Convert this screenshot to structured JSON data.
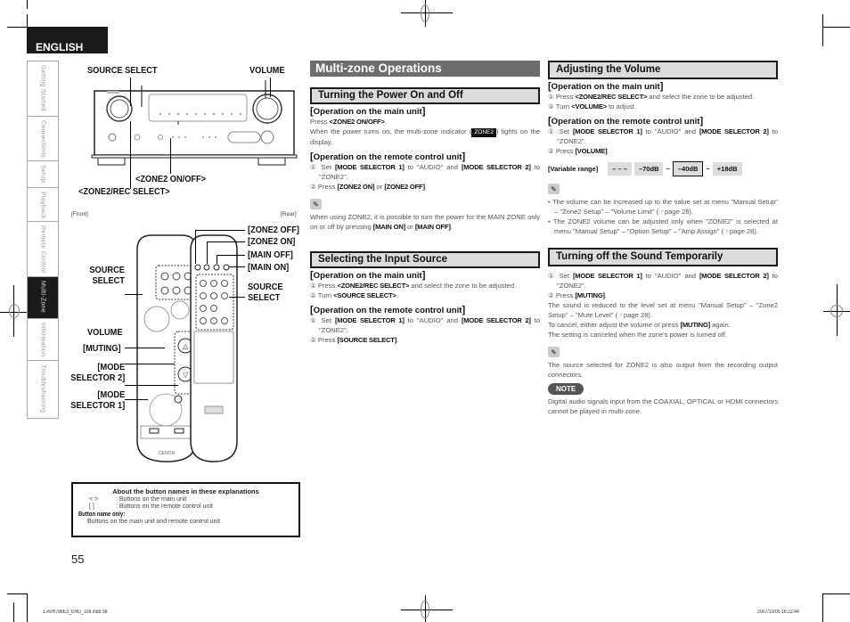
{
  "language_tab": "ENGLISH",
  "side_nav": [
    {
      "label": "Getting Started",
      "active": false
    },
    {
      "label": "Connections",
      "active": false
    },
    {
      "label": "Setup",
      "active": false
    },
    {
      "label": "Playback",
      "active": false
    },
    {
      "label": "Remote Control",
      "active": false
    },
    {
      "label": "Multi-Zone",
      "active": true
    },
    {
      "label": "Information",
      "active": false
    },
    {
      "label": "Troubleshooting",
      "active": false
    }
  ],
  "illustration": {
    "main_unit": {
      "source_select": "SOURCE SELECT",
      "volume": "VOLUME",
      "zone2_on_off": "<ZONE2 ON/OFF>",
      "zone2_rec_select": "<ZONE2/REC SELECT>"
    },
    "front_label": "[Front]",
    "rear_label": "[Rear]",
    "remote_front": {
      "source_select": "SOURCE\nSELECT",
      "volume": "VOLUME",
      "muting": "[MUTING]",
      "mode_selector_2": "[MODE\nSELECTOR 2]",
      "mode_selector_1": "[MODE\nSELECTOR 1]",
      "brand": "DENON"
    },
    "remote_rear": {
      "zone2_off": "[ZONE2 OFF]",
      "zone2_on": "[ZONE2 ON]",
      "main_off": "[MAIN OFF]",
      "main_on": "[MAIN ON]",
      "source_select": "SOURCE\nSELECT"
    }
  },
  "legend": {
    "title": "About the button names in these explanations",
    "rows": [
      {
        "symbol": "<   >",
        "text": ": Buttons on the main unit"
      },
      {
        "symbol": "[    ]",
        "text": ": Buttons on the remote control unit"
      }
    ],
    "button_name_only_label": "Button name only:",
    "button_name_only_text": "Buttons on the main unit and remote control unit"
  },
  "page_number": "55",
  "main_title": "Multi-zone Operations",
  "sections": {
    "power": {
      "title": "Turning the Power On and Off",
      "main_unit_heading": "Operation on the main unit",
      "main_unit_press": "Press ",
      "main_unit_press_btn": "<ZONE2 ON/OFF>",
      "main_unit_text_a": "When the power turns on, the multi-zone indicator (",
      "indicator": "ZONE2",
      "main_unit_text_b": ") lights on the display.",
      "remote_heading": "Operation on the remote control unit",
      "remote_step1_a": "① Set ",
      "remote_step1_b1": "[MODE SELECTOR 1]",
      "remote_step1_c": " to \"AUDIO\" and ",
      "remote_step1_b2": "[MODE SELECTOR 2]",
      "remote_step1_d": " to \"ZONE2\".",
      "remote_step2_a": "② Press ",
      "remote_step2_b1": "[ZONE2 ON]",
      "remote_step2_c": " or ",
      "remote_step2_b2": "[ZONE2 OFF]",
      "remote_step2_d": ".",
      "note_text_a": "When using ZONE2, it is possible to turn the power for the MAIN ZONE only on or off by pressing ",
      "note_btn1": "[MAIN ON]",
      "note_text_b": " or ",
      "note_btn2": "[MAIN OFF]",
      "note_text_c": "."
    },
    "input": {
      "title": "Selecting the Input Source",
      "main_unit_heading": "Operation on the main unit",
      "step1_a": "① Press ",
      "step1_btn": "<ZONE2/REC SELECT>",
      "step1_b": " and select the zone to be adjusted.",
      "step2_a": "② Turn ",
      "step2_btn": "<SOURCE SELECT>",
      "step2_b": ".",
      "remote_heading": "Operation on the remote control unit",
      "r_step1_a": "① Set ",
      "r_step1_b1": "[MODE SELECTOR 1]",
      "r_step1_c": " to \"AUDIO\" and ",
      "r_step1_b2": "[MODE SELECTOR 2]",
      "r_step1_d": " to \"ZONE2\".",
      "r_step2_a": "② Press ",
      "r_step2_btn": "[SOURCE SELECT]",
      "r_step2_b": "."
    },
    "volume": {
      "title": "Adjusting the Volume",
      "main_unit_heading": "Operation on the main unit",
      "step1_a": "① Press ",
      "step1_btn": "<ZONE2/REC SELECT>",
      "step1_b": " and select the zone to be adjusted.",
      "step2_a": "② Turn ",
      "step2_btn": "<VOLUME>",
      "step2_b": " to adjust.",
      "remote_heading": "Operation on the remote control unit",
      "r_step1_a": "① Set ",
      "r_step1_b1": "[MODE SELECTOR 1]",
      "r_step1_c": " to \"AUDIO\" and ",
      "r_step1_b2": "[MODE SELECTOR 2]",
      "r_step1_d": " to \"ZONE2\".",
      "r_step2_a": "② Press ",
      "r_step2_btn": "[VOLUME]",
      "r_step2_b": ".",
      "range_label": "[Variable range]",
      "range_values": [
        "– – –",
        "–70dB",
        "–40dB",
        "+18dB"
      ],
      "range_sep": "~",
      "range_default": "–40dB",
      "bullet1": "The volume can be increased up to the value set at menu \"Manual Setup\" – \"Zone2 Setup\" – \"Volume Limit\" (☞page 28).",
      "bullet2": "The ZONE2 volume can be adjusted only when \"ZONE2\" is selected at menu \"Manual Setup\" – \"Option Setup\" – \"Amp Assign\" (☞page 28)."
    },
    "mute": {
      "title": "Turning off the Sound Temporarily",
      "step1_a": "① Set ",
      "step1_b1": "[MODE SELECTOR 1]",
      "step1_c": " to \"AUDIO\" and ",
      "step1_b2": "[MODE SELECTOR 2]",
      "step1_d": " to \"ZONE2\".",
      "step2_a": "② Press ",
      "step2_btn": "[MUTING]",
      "step2_b": ".",
      "text1": "The sound is reduced to the level set at menu \"Manual Setup\" – \"Zone2 Setup\" – \"Mute Level\" (☞page 28).",
      "text2_a": "To cancel, either adjust the volume or press ",
      "text2_btn": "[MUTING]",
      "text2_b": " again.",
      "text3": "The setting is canceled when the zone's power is turned off.",
      "tip": "The source selected for ZONE2 is also output from the recording output connectors.",
      "note_badge": "NOTE",
      "note_text": "Digital audio signals input from the COAXIAL, OPTICAL or HDMI connectors cannot be played in multi-zone."
    }
  },
  "footer": {
    "file": "1.AVR788E3_ENG_108.indd   58",
    "timestamp": "2007/10/05   16:22:44"
  }
}
